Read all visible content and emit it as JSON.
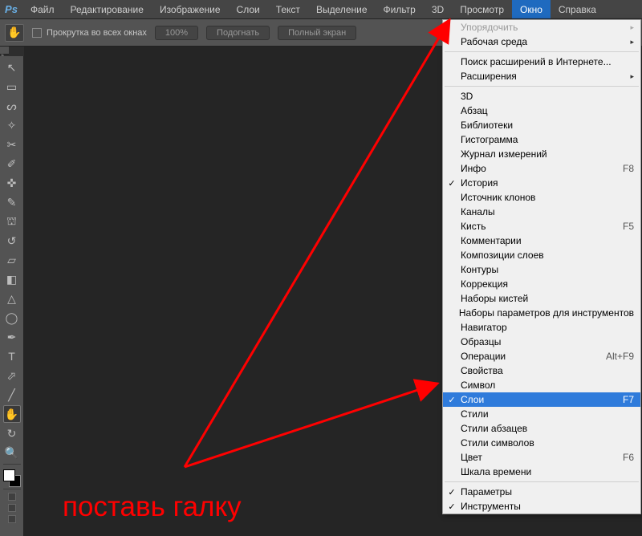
{
  "menubar": {
    "logo": "Ps",
    "items": [
      "Файл",
      "Редактирование",
      "Изображение",
      "Слои",
      "Текст",
      "Выделение",
      "Фильтр",
      "3D",
      "Просмотр",
      "Окно",
      "Справка"
    ],
    "open_index": 9
  },
  "optionsbar": {
    "tool_icon": "✋",
    "scroll_all_label": "Прокрутка во всех окнах",
    "buttons": [
      "100%",
      "Подогнать",
      "Полный экран"
    ]
  },
  "toolbar": {
    "tools": [
      {
        "name": "move-tool",
        "glyph": "↖"
      },
      {
        "name": "rect-marquee-tool",
        "glyph": "▭"
      },
      {
        "name": "lasso-tool",
        "glyph": "ᔕ"
      },
      {
        "name": "magic-wand-tool",
        "glyph": "✧"
      },
      {
        "name": "crop-tool",
        "glyph": "✂"
      },
      {
        "name": "eyedropper-tool",
        "glyph": "✐"
      },
      {
        "name": "spot-heal-tool",
        "glyph": "✜"
      },
      {
        "name": "brush-tool",
        "glyph": "✎"
      },
      {
        "name": "clone-stamp-tool",
        "glyph": "⛫"
      },
      {
        "name": "history-brush-tool",
        "glyph": "↺"
      },
      {
        "name": "eraser-tool",
        "glyph": "▱"
      },
      {
        "name": "gradient-tool",
        "glyph": "◧"
      },
      {
        "name": "blur-tool",
        "glyph": "△"
      },
      {
        "name": "dodge-tool",
        "glyph": "◯"
      },
      {
        "name": "pen-tool",
        "glyph": "✒"
      },
      {
        "name": "type-tool",
        "glyph": "T"
      },
      {
        "name": "selection-tool",
        "glyph": "⬀"
      },
      {
        "name": "shape-tool",
        "glyph": "╱"
      },
      {
        "name": "hand-tool",
        "glyph": "✋",
        "active": true
      },
      {
        "name": "rotate-view-tool",
        "glyph": "↻"
      },
      {
        "name": "zoom-tool",
        "glyph": "🔍"
      }
    ]
  },
  "dropdown": {
    "sections": [
      [
        {
          "label": "Упорядочить",
          "disabled": true,
          "submenu": true
        },
        {
          "label": "Рабочая среда",
          "submenu": true
        }
      ],
      [
        {
          "label": "Поиск расширений в Интернете..."
        },
        {
          "label": "Расширения",
          "submenu": true
        }
      ],
      [
        {
          "label": "3D"
        },
        {
          "label": "Абзац"
        },
        {
          "label": "Библиотеки"
        },
        {
          "label": "Гистограмма"
        },
        {
          "label": "Журнал измерений"
        },
        {
          "label": "Инфо",
          "shortcut": "F8"
        },
        {
          "label": "История",
          "checked": true
        },
        {
          "label": "Источник клонов"
        },
        {
          "label": "Каналы"
        },
        {
          "label": "Кисть",
          "shortcut": "F5"
        },
        {
          "label": "Комментарии"
        },
        {
          "label": "Композиции слоев"
        },
        {
          "label": "Контуры"
        },
        {
          "label": "Коррекция"
        },
        {
          "label": "Наборы кистей"
        },
        {
          "label": "Наборы параметров для инструментов"
        },
        {
          "label": "Навигатор"
        },
        {
          "label": "Образцы"
        },
        {
          "label": "Операции",
          "shortcut": "Alt+F9"
        },
        {
          "label": "Свойства"
        },
        {
          "label": "Символ"
        },
        {
          "label": "Слои",
          "shortcut": "F7",
          "checked": true,
          "highlight": true
        },
        {
          "label": "Стили"
        },
        {
          "label": "Стили абзацев"
        },
        {
          "label": "Стили символов"
        },
        {
          "label": "Цвет",
          "shortcut": "F6"
        },
        {
          "label": "Шкала времени"
        }
      ],
      [
        {
          "label": "Параметры",
          "checked": true
        },
        {
          "label": "Инструменты",
          "checked": true
        }
      ]
    ]
  },
  "annotation": {
    "text": "поставь галку"
  }
}
